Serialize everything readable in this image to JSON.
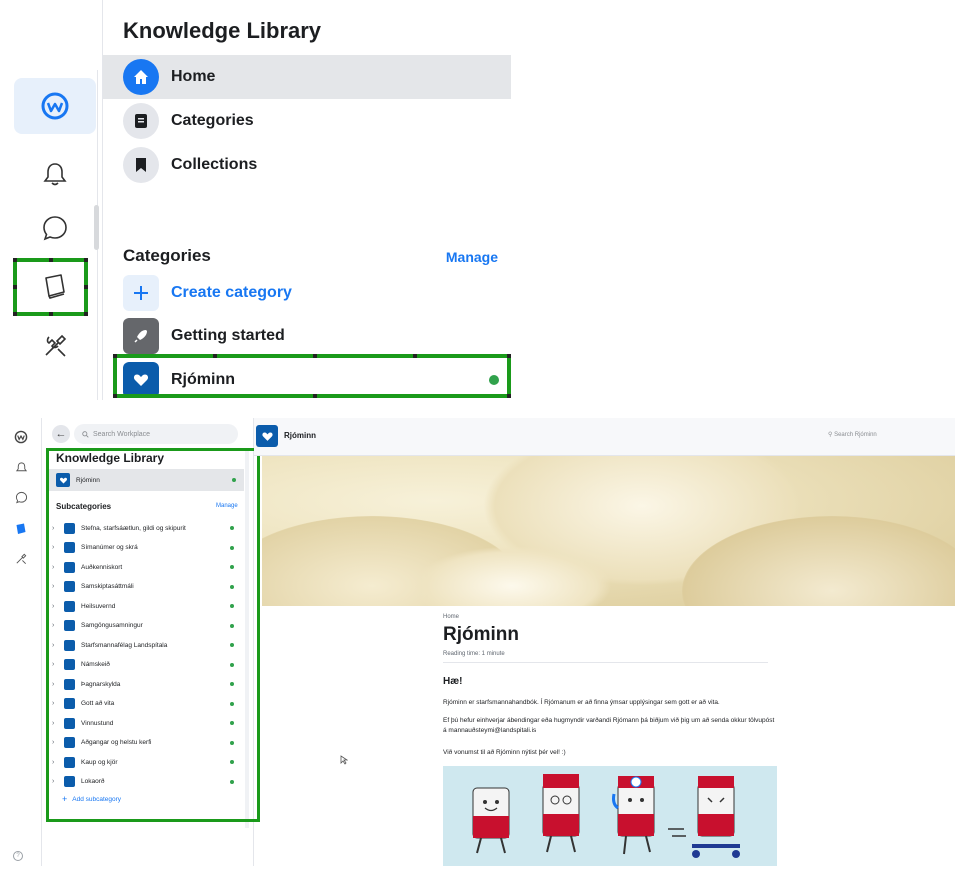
{
  "zoom": {
    "title": "Knowledge Library",
    "nav": [
      {
        "label": "Home",
        "icon": "home-icon"
      },
      {
        "label": "Categories",
        "icon": "document-icon"
      },
      {
        "label": "Collections",
        "icon": "bookmark-icon"
      }
    ],
    "categories_heading": "Categories",
    "manage": "Manage",
    "create_category": "Create category",
    "getting_started": "Getting started",
    "rjominn": "Rjóminn"
  },
  "sidebar": {
    "search_placeholder": "Search Workplace",
    "title": "Knowledge Library",
    "current": "Rjóminn",
    "subcategories_heading": "Subcategories",
    "manage": "Manage",
    "items": [
      "Stefna, starfsáætlun, gildi og skipurit",
      "Símanúmer og skrá",
      "Auðkenniskort",
      "Samskiptasáttmáli",
      "Heilsuvernd",
      "Samgöngusamningur",
      "Starfsmannafélag Landspítala",
      "Námskeið",
      "Þagnarskylda",
      "Gott að vita",
      "Vinnustund",
      "Aðgangar og helstu kerfi",
      "Kaup og kjör",
      "Lokaorð"
    ],
    "add_subcategory": "Add subcategory"
  },
  "header": {
    "title": "Rjóminn",
    "search_placeholder": "Search Rjóminn"
  },
  "article": {
    "breadcrumb": "Home",
    "title": "Rjóminn",
    "reading_time": "Reading time: 1 minute",
    "heading": "Hæ!",
    "p1": "Rjóminn er starfsmannahandbók. Í Rjómanum er að finna ýmsar upplýsingar sem gott er að vita.",
    "p2": "Ef þú hefur einhverjar ábendingar eða hugmyndir varðandi Rjómann þá biðjum við þig um að senda okkur tölvupóst á mannauðsteymi@landspitali.is",
    "p3": "Við vonumst til að Rjóminn nýtist þér vel! :)"
  },
  "colors": {
    "accent": "#1877f2",
    "category_blue": "#0b5cab",
    "highlight": "#1a9a1a",
    "status_green": "#31a24c"
  }
}
